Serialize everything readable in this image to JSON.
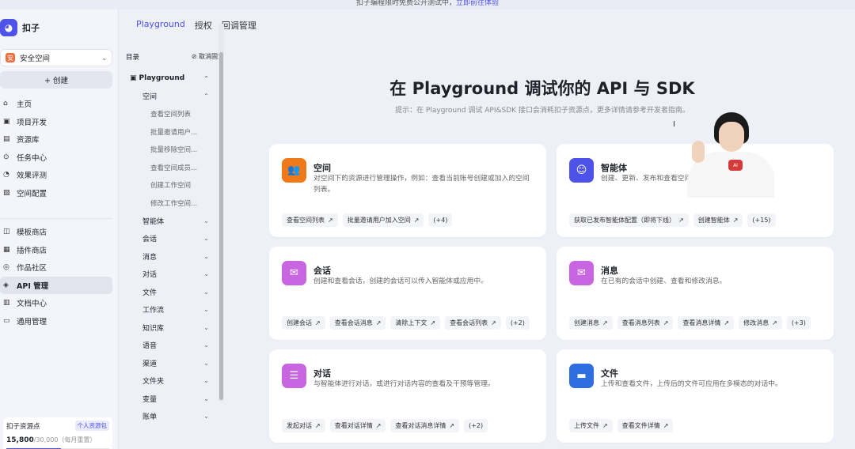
{
  "banner": {
    "text": "扣子编程限时免费公开测试中，",
    "link": "立即前往体验"
  },
  "brand": {
    "name": "扣子",
    "logo_icon": "robot-face-icon"
  },
  "space": {
    "name": "安全空间",
    "badge": "安"
  },
  "create_label": "+ 创建",
  "nav_primary": [
    {
      "label": "主页",
      "icon": "⌂"
    },
    {
      "label": "项目开发",
      "icon": "▣"
    },
    {
      "label": "资源库",
      "icon": "▤"
    },
    {
      "label": "任务中心",
      "icon": "⊙"
    },
    {
      "label": "效果评测",
      "icon": "◔"
    },
    {
      "label": "空间配置",
      "icon": "▧"
    }
  ],
  "nav_secondary": [
    {
      "label": "模板商店",
      "icon": "◫"
    },
    {
      "label": "插件商店",
      "icon": "▦"
    },
    {
      "label": "作品社区",
      "icon": "◎"
    },
    {
      "label": "API 管理",
      "icon": "◈",
      "active": true
    },
    {
      "label": "文档中心",
      "icon": "▥"
    },
    {
      "label": "通用管理",
      "icon": "▭"
    }
  ],
  "resource": {
    "title": "扣子资源点",
    "tag": "个人资源包",
    "used": "15,800",
    "total": "/30,000",
    "note": "（每月重置）",
    "progress": 0.53
  },
  "topnav": [
    {
      "label": "Playground",
      "active": true
    },
    {
      "label": "授权",
      "active": false
    },
    {
      "label": "回调管理",
      "active": false
    }
  ],
  "tree": {
    "title": "目录",
    "unpin": "取消固定",
    "unpin_icon": "pin-off-icon",
    "rows": [
      {
        "level": 0,
        "label": "Playground",
        "chev": "⌃"
      },
      {
        "level": 1,
        "label": "空间",
        "chev": "⌃"
      },
      {
        "level": 2,
        "label": "查看空间列表"
      },
      {
        "level": 2,
        "label": "批量邀请用户..."
      },
      {
        "level": 2,
        "label": "批量移除空间..."
      },
      {
        "level": 2,
        "label": "查看空间成员..."
      },
      {
        "level": 2,
        "label": "创建工作空间"
      },
      {
        "level": 2,
        "label": "修改工作空间..."
      },
      {
        "level": 1,
        "label": "智能体",
        "chev": "⌄"
      },
      {
        "level": 1,
        "label": "会话",
        "chev": "⌄"
      },
      {
        "level": 1,
        "label": "消息",
        "chev": "⌄"
      },
      {
        "level": 1,
        "label": "对话",
        "chev": "⌄"
      },
      {
        "level": 1,
        "label": "文件",
        "chev": "⌄"
      },
      {
        "level": 1,
        "label": "工作流",
        "chev": "⌄"
      },
      {
        "level": 1,
        "label": "知识库",
        "chev": "⌄"
      },
      {
        "level": 1,
        "label": "语音",
        "chev": "⌄"
      },
      {
        "level": 1,
        "label": "渠道",
        "chev": "⌄"
      },
      {
        "level": 1,
        "label": "文件夹",
        "chev": "⌄"
      },
      {
        "level": 1,
        "label": "变量",
        "chev": "⌄"
      },
      {
        "level": 1,
        "label": "账单",
        "chev": "⌄"
      }
    ]
  },
  "hero": {
    "title": "在 Playground 调试你的 API 与 SDK",
    "tip": "提示：在 Playground 调试 API&SDK 接口会消耗扣子资源点，更多详情请参考开发者指南。"
  },
  "cards": [
    {
      "title": "空间",
      "icon": "users-icon",
      "glyph": "👥",
      "color": "#f07a1a",
      "desc": "对空间下的资源进行管理操作，例如：查看当前账号创建或加入的空间列表。",
      "tags": [
        "查看空间列表",
        "批量邀请用户加入空间"
      ],
      "more": "(+4)"
    },
    {
      "title": "智能体",
      "icon": "bot-icon",
      "glyph": "☺",
      "color": "#4d53e8",
      "desc": "创建、更新、发布和查看空间下的智能体。",
      "tags": [
        "获取已发布智能体配置（即将下线）",
        "创建智能体"
      ],
      "more": "(+15)"
    },
    {
      "title": "会话",
      "icon": "chat-icon",
      "glyph": "✉",
      "color": "#c865e0",
      "desc": "创建和查看会话，创建的会话可以传入智能体或应用中。",
      "tags": [
        "创建会话",
        "查看会话消息",
        "清除上下文",
        "查看会话列表"
      ],
      "more": "(+2)"
    },
    {
      "title": "消息",
      "icon": "message-icon",
      "glyph": "✉",
      "color": "#c865e0",
      "desc": "在已有的会话中创建、查看和修改消息。",
      "tags": [
        "创建消息",
        "查看消息列表",
        "查看消息详情",
        "修改消息"
      ],
      "more": "(+3)"
    },
    {
      "title": "对话",
      "icon": "dialog-icon",
      "glyph": "☰",
      "color": "#c865e0",
      "desc": "与智能体进行对话，或进行对话内容的查看及干预等管理。",
      "tags": [
        "发起对话",
        "查看对话详情",
        "查看对话消息详情"
      ],
      "more": "(+2)"
    },
    {
      "title": "文件",
      "icon": "folder-icon",
      "glyph": "▬",
      "color": "#2f6ee0",
      "desc": "上传和查看文件，上传后的文件可应用在多模态的对话中。",
      "tags": [
        "上传文件",
        "查看文件详情"
      ],
      "more": ""
    }
  ],
  "presenter_badge": "AI"
}
